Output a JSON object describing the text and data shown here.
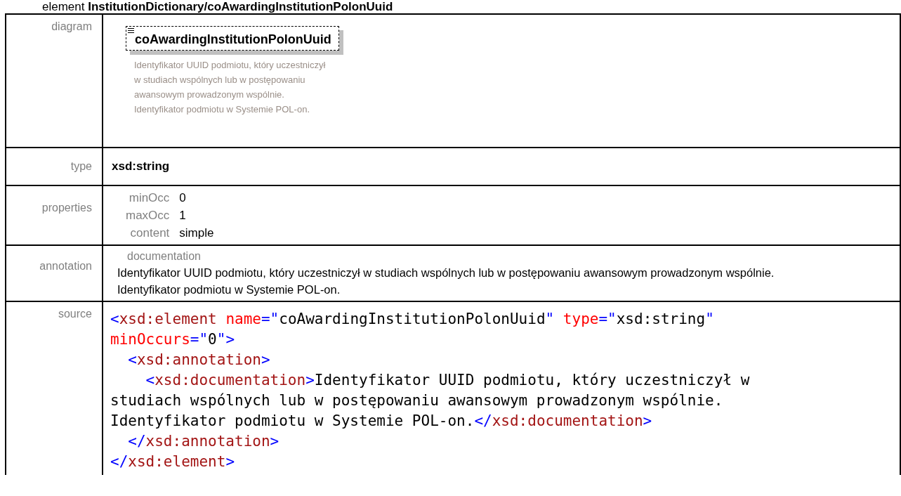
{
  "title": {
    "prefix": "element",
    "path": "InstitutionDictionary/coAwardingInstitutionPolonUuid"
  },
  "rows": [
    {
      "kind": "diagram",
      "label": "diagram",
      "element_name": "coAwardingInstitutionPolonUuid",
      "description": "Identyfikator UUID podmiotu, który uczestniczył w studiach wspólnych lub w postępowaniu awansowym prowadzonym wspólnie. Identyfikator podmiotu w Systemie POL-on."
    },
    {
      "kind": "type",
      "label": "type",
      "value": "xsd:string"
    },
    {
      "kind": "properties",
      "label": "properties",
      "items": [
        {
          "name": "minOcc",
          "value": "0"
        },
        {
          "name": "maxOcc",
          "value": "1"
        },
        {
          "name": "content",
          "value": "simple"
        }
      ]
    },
    {
      "kind": "annotation",
      "label": "annotation",
      "heading": "documentation",
      "text": "Identyfikator UUID podmiotu, który uczestniczył w studiach wspólnych lub w postępowaniu awansowym prowadzonym wspólnie. Identyfikator podmiotu w Systemie POL-on."
    },
    {
      "kind": "source",
      "label": "source",
      "lines": [
        [
          {
            "kind": "punct",
            "text": "<"
          },
          {
            "kind": "element",
            "text": "xsd:element"
          },
          {
            "kind": "attr",
            "text": " name"
          },
          {
            "kind": "punct",
            "text": "=\""
          },
          {
            "kind": "text",
            "text": "coAwardingInstitutionPolonUuid"
          },
          {
            "kind": "punct",
            "text": "\""
          },
          {
            "kind": "attr",
            "text": " type"
          },
          {
            "kind": "punct",
            "text": "=\""
          },
          {
            "kind": "text",
            "text": "xsd:string"
          },
          {
            "kind": "punct",
            "text": "\""
          }
        ],
        [
          {
            "kind": "attr",
            "text": "minOccurs"
          },
          {
            "kind": "punct",
            "text": "=\""
          },
          {
            "kind": "text",
            "text": "0"
          },
          {
            "kind": "punct",
            "text": "\">"
          }
        ],
        [
          {
            "kind": "punct",
            "text": "  <"
          },
          {
            "kind": "element",
            "text": "xsd:annotation"
          },
          {
            "kind": "punct",
            "text": ">"
          }
        ],
        [
          {
            "kind": "punct",
            "text": "    <"
          },
          {
            "kind": "element",
            "text": "xsd:documentation"
          },
          {
            "kind": "punct",
            "text": ">"
          },
          {
            "kind": "text",
            "text": "Identyfikator UUID podmiotu, który uczestniczył w"
          }
        ],
        [
          {
            "kind": "text",
            "text": "studiach wspólnych lub w postępowaniu awansowym prowadzonym wspólnie."
          }
        ],
        [
          {
            "kind": "text",
            "text": "Identyfikator podmiotu w Systemie POL-on."
          },
          {
            "kind": "punct",
            "text": "</"
          },
          {
            "kind": "element",
            "text": "xsd:documentation"
          },
          {
            "kind": "punct",
            "text": ">"
          }
        ],
        [
          {
            "kind": "punct",
            "text": "  </"
          },
          {
            "kind": "element",
            "text": "xsd:annotation"
          },
          {
            "kind": "punct",
            "text": ">"
          }
        ],
        [
          {
            "kind": "punct",
            "text": "</"
          },
          {
            "kind": "element",
            "text": "xsd:element"
          },
          {
            "kind": "punct",
            "text": ">"
          }
        ]
      ]
    }
  ]
}
